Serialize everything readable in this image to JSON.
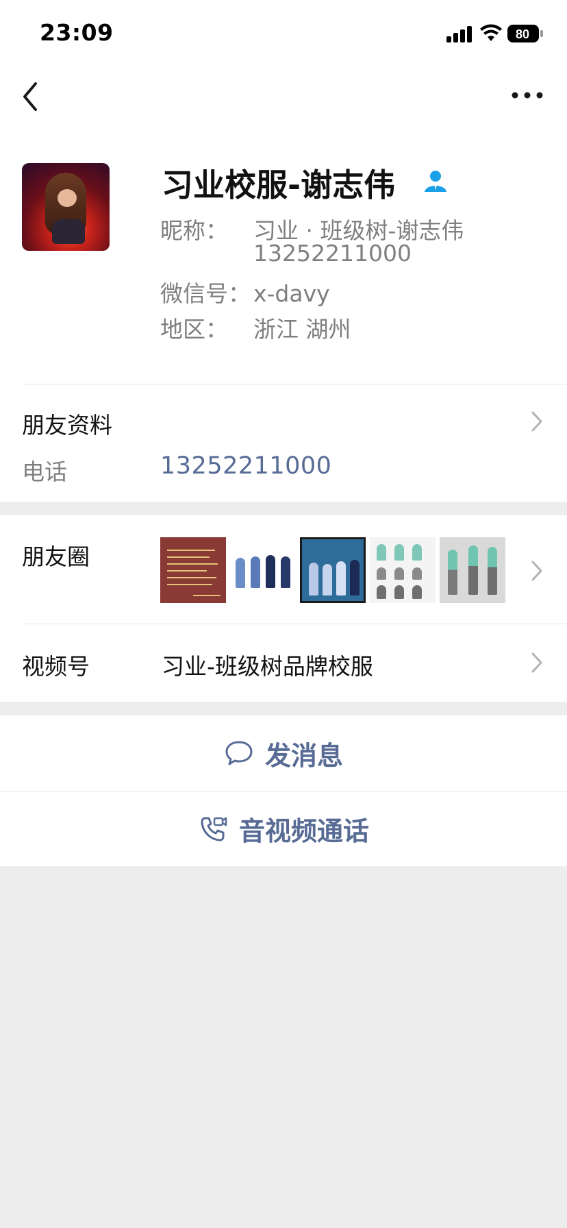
{
  "status_bar": {
    "time": "23:09",
    "battery": "80"
  },
  "profile": {
    "display_name": "习业校服-谢志伟",
    "nickname_label": "昵称：",
    "nickname_value": "习业 · 班级树-谢志伟",
    "nickname_value_line2": "13252211000",
    "wechat_id_label": "微信号：",
    "wechat_id_value": "x-davy",
    "region_label": "地区：",
    "region_value": "浙江  湖州"
  },
  "friend_info": {
    "title": "朋友资料",
    "phone_label": "电话",
    "phone_value": "13252211000"
  },
  "moments": {
    "title": "朋友圈"
  },
  "channels": {
    "title": "视频号",
    "value": "习业-班级树品牌校服"
  },
  "actions": {
    "message_label": "发消息",
    "call_label": "音视频通话"
  },
  "colors": {
    "link_blue": "#576b95",
    "contact_icon_blue": "#1aa0e6",
    "background_gray": "#ededed"
  },
  "icons": [
    "back-arrow-icon",
    "more-dots-icon",
    "contact-person-icon",
    "chevron-right-icon",
    "chat-bubble-icon",
    "video-call-icon"
  ]
}
